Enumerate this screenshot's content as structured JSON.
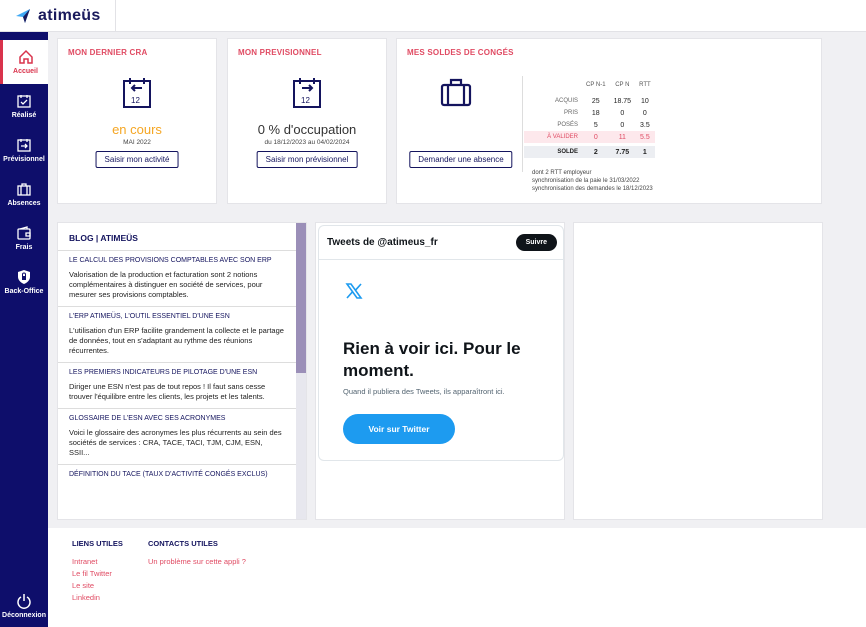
{
  "app": {
    "logo_text": "atimeüs"
  },
  "sidebar": {
    "items": [
      {
        "label": "Accueil",
        "icon": "home-icon",
        "active": true
      },
      {
        "label": "Réalisé",
        "icon": "calendar-check-icon"
      },
      {
        "label": "Prévisionnel",
        "icon": "calendar-forward-icon"
      },
      {
        "label": "Absences",
        "icon": "briefcase-icon"
      },
      {
        "label": "Frais",
        "icon": "wallet-icon"
      },
      {
        "label": "Back-Office",
        "icon": "shield-icon"
      }
    ],
    "logout_label": "Déconnexion"
  },
  "cra": {
    "title": "MON DERNIER CRA",
    "icon_number": "12",
    "status": "en cours",
    "period": "MAI 2022",
    "button": "Saisir mon activité"
  },
  "previsionnel": {
    "title": "MON PREVISIONNEL",
    "icon_number": "12",
    "occupation": "0 % d'occupation",
    "period": "du 18/12/2023 au 04/02/2024",
    "button": "Saisir mon prévisionnel"
  },
  "conges": {
    "title": "MES SOLDES DE CONGÉS",
    "button": "Demander une absence",
    "columns": [
      "CP N-1",
      "CP N",
      "RTT"
    ],
    "rows": [
      {
        "label": "ACQUIS",
        "values": [
          "25",
          "18.75",
          "10"
        ]
      },
      {
        "label": "PRIS",
        "values": [
          "18",
          "0",
          "0"
        ]
      },
      {
        "label": "POSÉS",
        "values": [
          "5",
          "0",
          "3.5"
        ]
      },
      {
        "label": "À VALIDER",
        "values": [
          "0",
          "11",
          "5.5"
        ]
      },
      {
        "label": "SOLDE",
        "values": [
          "2",
          "7.75",
          "1"
        ]
      }
    ],
    "notes": [
      "dont 2 RTT employeur",
      "synchronisation de la paie le 31/03/2022",
      "synchronisation des demandes le 18/12/2023"
    ]
  },
  "blog": {
    "title": "BLOG | ATIMEÜS",
    "items": [
      {
        "title": "LE CALCUL DES PROVISIONS COMPTABLES AVEC SON ERP",
        "desc": "Valorisation de la production et facturation sont 2 notions complémentaires à distinguer en société de services, pour mesurer ses provisions comptables."
      },
      {
        "title": "L'ERP ATIMEÜS, L'OUTIL ESSENTIEL D'UNE ESN",
        "desc": "L'utilisation d'un ERP facilite grandement la collecte et le partage de données, tout en s'adaptant au rythme des réunions récurrentes."
      },
      {
        "title": "LES PREMIERS INDICATEURS DE PILOTAGE D'UNE ESN",
        "desc": "Diriger une ESN n'est pas de tout repos ! Il faut sans cesse trouver l'équilibre entre les clients, les projets et les talents."
      },
      {
        "title": "GLOSSAIRE DE L'ESN AVEC SES ACRONYMES",
        "desc": "Voici le glossaire des acronymes les plus récurrents au sein des sociétés de services : CRA, TACE, TACI, TJM, CJM, ESN, SSII..."
      },
      {
        "title": "DÉFINITION DU TACE (TAUX D'ACTIVITÉ CONGÉS EXCLUS)",
        "desc": ""
      }
    ]
  },
  "twitter": {
    "header": "Tweets de @atimeus_fr",
    "follow": "Suivre",
    "empty_title": "Rien à voir ici. Pour le moment.",
    "empty_sub": "Quand il publiera des Tweets, ils apparaîtront ici.",
    "button": "Voir sur Twitter"
  },
  "footer": {
    "useful_title": "LIENS UTILES",
    "useful_links": [
      "Intranet",
      "Le fil Twitter",
      "Le site",
      "Linkedin"
    ],
    "contacts_title": "CONTACTS UTILES",
    "contacts_links": [
      "Un problème sur cette appli ?"
    ]
  },
  "colors": {
    "sidebar": "#0e0e6b",
    "accent": "#e04b63",
    "status_orange": "#f5a623",
    "twitter_blue": "#1d9bf0"
  }
}
